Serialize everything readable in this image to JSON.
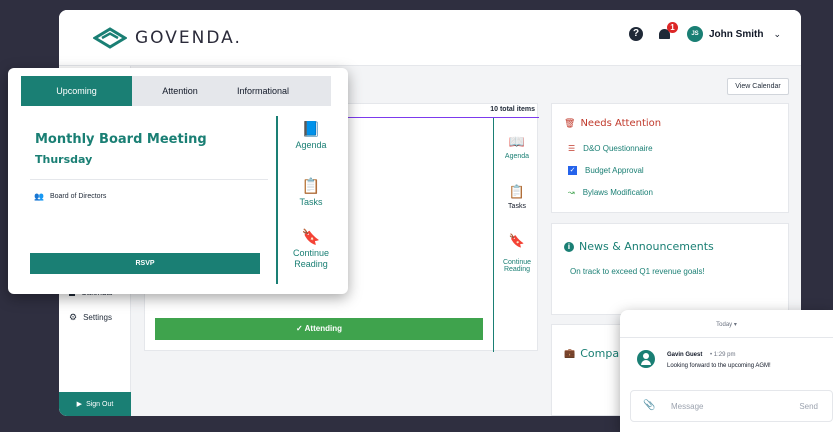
{
  "brand": {
    "name": "GOVENDA."
  },
  "header": {
    "help_icon": "question-circle-icon",
    "notification_count": "1",
    "user_initials": "JS",
    "user_name": "John Smith"
  },
  "sidebar": {
    "items": [
      {
        "label": "Calendar",
        "icon": "calendar-icon"
      },
      {
        "label": "Settings",
        "icon": "gear-icon"
      }
    ],
    "sign_out": "Sign Out"
  },
  "main": {
    "view_calendar": "View Calendar",
    "total_items": "10 total items",
    "actions": [
      {
        "label": "Agenda",
        "icon": "book-icon"
      },
      {
        "label": "Tasks",
        "icon": "clipboard-icon"
      },
      {
        "label": "Continue\nReading",
        "icon": "bookmark-icon"
      }
    ],
    "attending": "✓ Attending"
  },
  "needs_attention": {
    "title": "Needs Attention",
    "items": [
      {
        "label": "D&O Questionnaire",
        "icon": "list-icon"
      },
      {
        "label": "Budget Approval",
        "icon": "checkbox-icon"
      },
      {
        "label": "Bylaws Modification",
        "icon": "signature-icon"
      }
    ]
  },
  "news": {
    "title": "News & Announcements",
    "item": "On track to exceed Q1 revenue goals!"
  },
  "company": {
    "title": "Company"
  },
  "upcoming": {
    "tabs": [
      "Upcoming",
      "Attention",
      "Informational"
    ],
    "meeting_title": "Monthly Board Meeting",
    "meeting_day": "Thursday",
    "attendees": "Board of Directors",
    "rsvp": "RSVP",
    "actions": [
      {
        "label": "Agenda",
        "icon": "book-icon"
      },
      {
        "label": "Tasks",
        "icon": "clipboard-check-icon"
      },
      {
        "label": "Continue Reading",
        "icon": "bookmark-icon"
      }
    ]
  },
  "chat": {
    "date": "Today",
    "sender": "Gavin Guest",
    "time": "• 1:29 pm",
    "message": "Looking forward to the upcoming AGM!",
    "placeholder": "Message",
    "send": "Send"
  },
  "colors": {
    "accent": "#1a7f74",
    "attending": "#3fa34d",
    "alert": "#c0392b",
    "background": "#2f2f40"
  }
}
